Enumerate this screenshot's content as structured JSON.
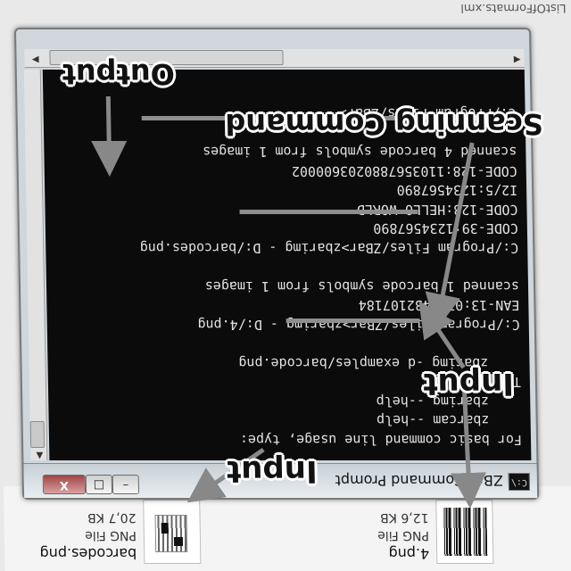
{
  "explorer": {
    "top_right_text": "ListOfFormats.xml",
    "files": [
      {
        "name": "4.png",
        "type": "PNG File",
        "size": "12,6 KB",
        "thumb": "linear-barcode"
      },
      {
        "name": "barcodes.png",
        "type": "PNG File",
        "size": "20,7 KB",
        "thumb": "mixed-barcodes"
      }
    ]
  },
  "window": {
    "title": "ZBar Command Prompt",
    "icon_label": "C:\\",
    "controls": {
      "minimize": "–",
      "maximize": "□",
      "close": "X"
    }
  },
  "console": {
    "lines": [
      "For basic command line usage, type:",
      "    zbarcam --help",
      "    zbarimg --help",
      "Try running:",
      "    zbarimg -d examples/barcode.png",
      "",
      "C:/Program Files/ZBar>zbarimg - D:/4.png",
      "EAN-13:0715432107184",
      "scanned 1 barcode symbols from 1 images",
      "",
      "C:/Program Files/ZBar>zbarimg - D:/barcodes.png",
      "CODE-39:1234567890",
      "CODE-128:HELLO WORLD",
      "I2/5:1234567890",
      "CODE-128:1103567880203600002",
      "scanned 4 barcode symbols from 1 images",
      "",
      "C:/Program Files/ZBar>"
    ]
  },
  "annotations": {
    "input_a": "Input",
    "input_b": "Input",
    "scanning_command": "Scanning Command",
    "output": "Output"
  },
  "colors": {
    "console_bg": "#0b0b0b",
    "console_text": "#e2e2e2",
    "highlight": "#8e8e8e"
  }
}
